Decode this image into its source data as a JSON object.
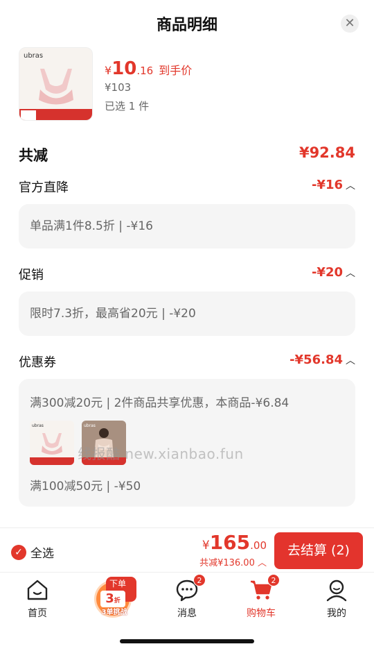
{
  "header": {
    "title": "商品明细",
    "close_icon": "close-icon"
  },
  "product": {
    "brand": "ubras",
    "price_currency": "¥",
    "price_int": "10",
    "price_dec": ".16",
    "price_tag": "到手价",
    "original_price": "¥103",
    "selected_text": "已选 1 件"
  },
  "discount": {
    "total_label": "共减",
    "total_amount": "¥92.84",
    "sections": [
      {
        "title": "官方直降",
        "amount": "-¥16",
        "detail": "单品满1件8.5折 | -¥16"
      },
      {
        "title": "促销",
        "amount": "-¥20",
        "detail": "限时7.3折，最高省20元 | -¥20"
      },
      {
        "title": "优惠券",
        "amount": "-¥56.84",
        "detail": "满300减20元 | 2件商品共享优惠，本商品-¥6.84",
        "detail2": "满100减50元 | -¥50"
      }
    ]
  },
  "watermark": "线报酷 new.xianbao.fun",
  "checkout": {
    "select_all": "全选",
    "total_currency": "¥",
    "total_int": "165",
    "total_dec": ".00",
    "discount_text": "共减¥136.00",
    "button": "去结算 (2)"
  },
  "tabbar": {
    "home": "首页",
    "promo_tag": "下单返",
    "promo_number": "3",
    "promo_unit": "折",
    "promo_sub": "3单挑战",
    "messages": "消息",
    "messages_badge": "2",
    "cart": "购物车",
    "cart_badge": "2",
    "me": "我的"
  },
  "colors": {
    "accent": "#e2372b",
    "background": "#f3f3f3"
  }
}
